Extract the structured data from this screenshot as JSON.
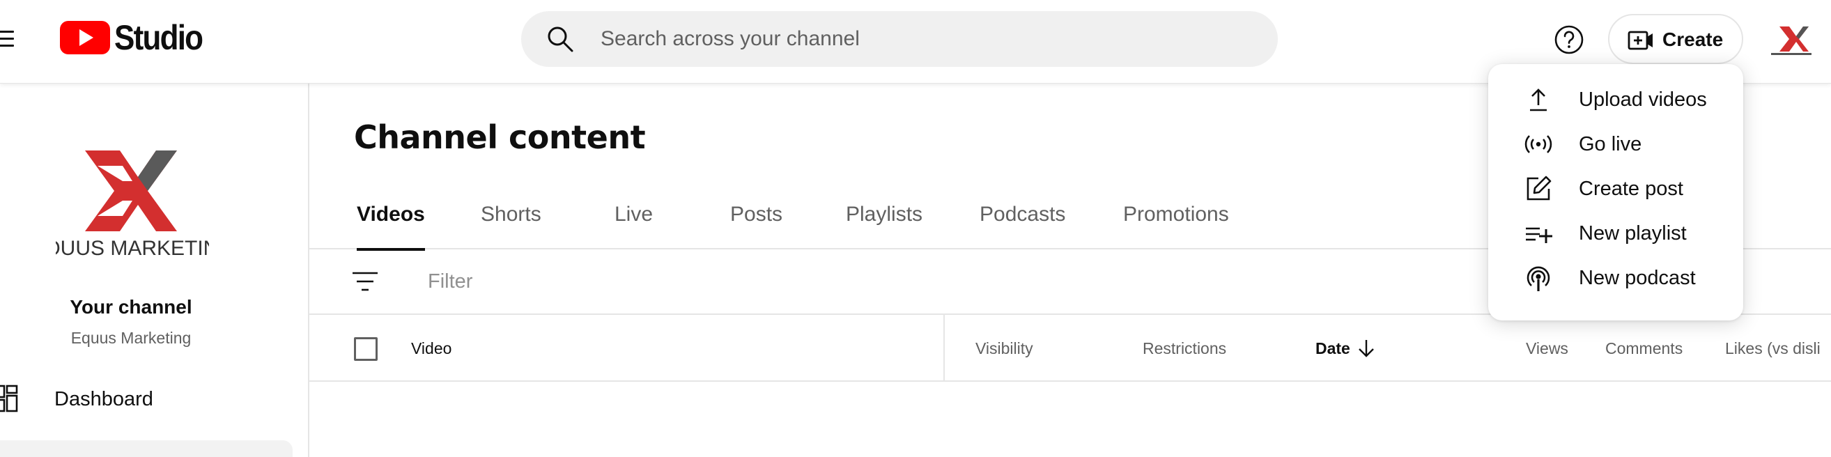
{
  "header": {
    "app_name": "Studio",
    "search": {
      "placeholder": "Search across your channel",
      "value": ""
    },
    "create_label": "Create",
    "brand_red": "#ff0000"
  },
  "sidebar": {
    "channel_logo_text": "EQUUS MARKETING",
    "channel_name": "Your channel",
    "channel_handle": "Equus Marketing",
    "items": [
      {
        "label": "Dashboard",
        "icon": "dashboard-icon"
      }
    ]
  },
  "main": {
    "title": "Channel content",
    "tabs": [
      {
        "label": "Videos",
        "active": true
      },
      {
        "label": "Shorts"
      },
      {
        "label": "Live"
      },
      {
        "label": "Posts"
      },
      {
        "label": "Playlists"
      },
      {
        "label": "Podcasts"
      },
      {
        "label": "Promotions"
      }
    ],
    "filter": {
      "placeholder": "Filter",
      "value": ""
    },
    "table": {
      "columns": [
        "Video",
        "Visibility",
        "Restrictions",
        "Date",
        "Views",
        "Comments",
        "Likes (vs disli"
      ],
      "sorted_column": "Date",
      "sort_direction": "descending"
    }
  },
  "create_menu": {
    "items": [
      {
        "label": "Upload videos",
        "icon": "upload-icon"
      },
      {
        "label": "Go live",
        "icon": "live-broadcast-icon"
      },
      {
        "label": "Create post",
        "icon": "edit-post-icon"
      },
      {
        "label": "New playlist",
        "icon": "playlist-add-icon"
      },
      {
        "label": "New podcast",
        "icon": "podcast-icon"
      }
    ]
  }
}
